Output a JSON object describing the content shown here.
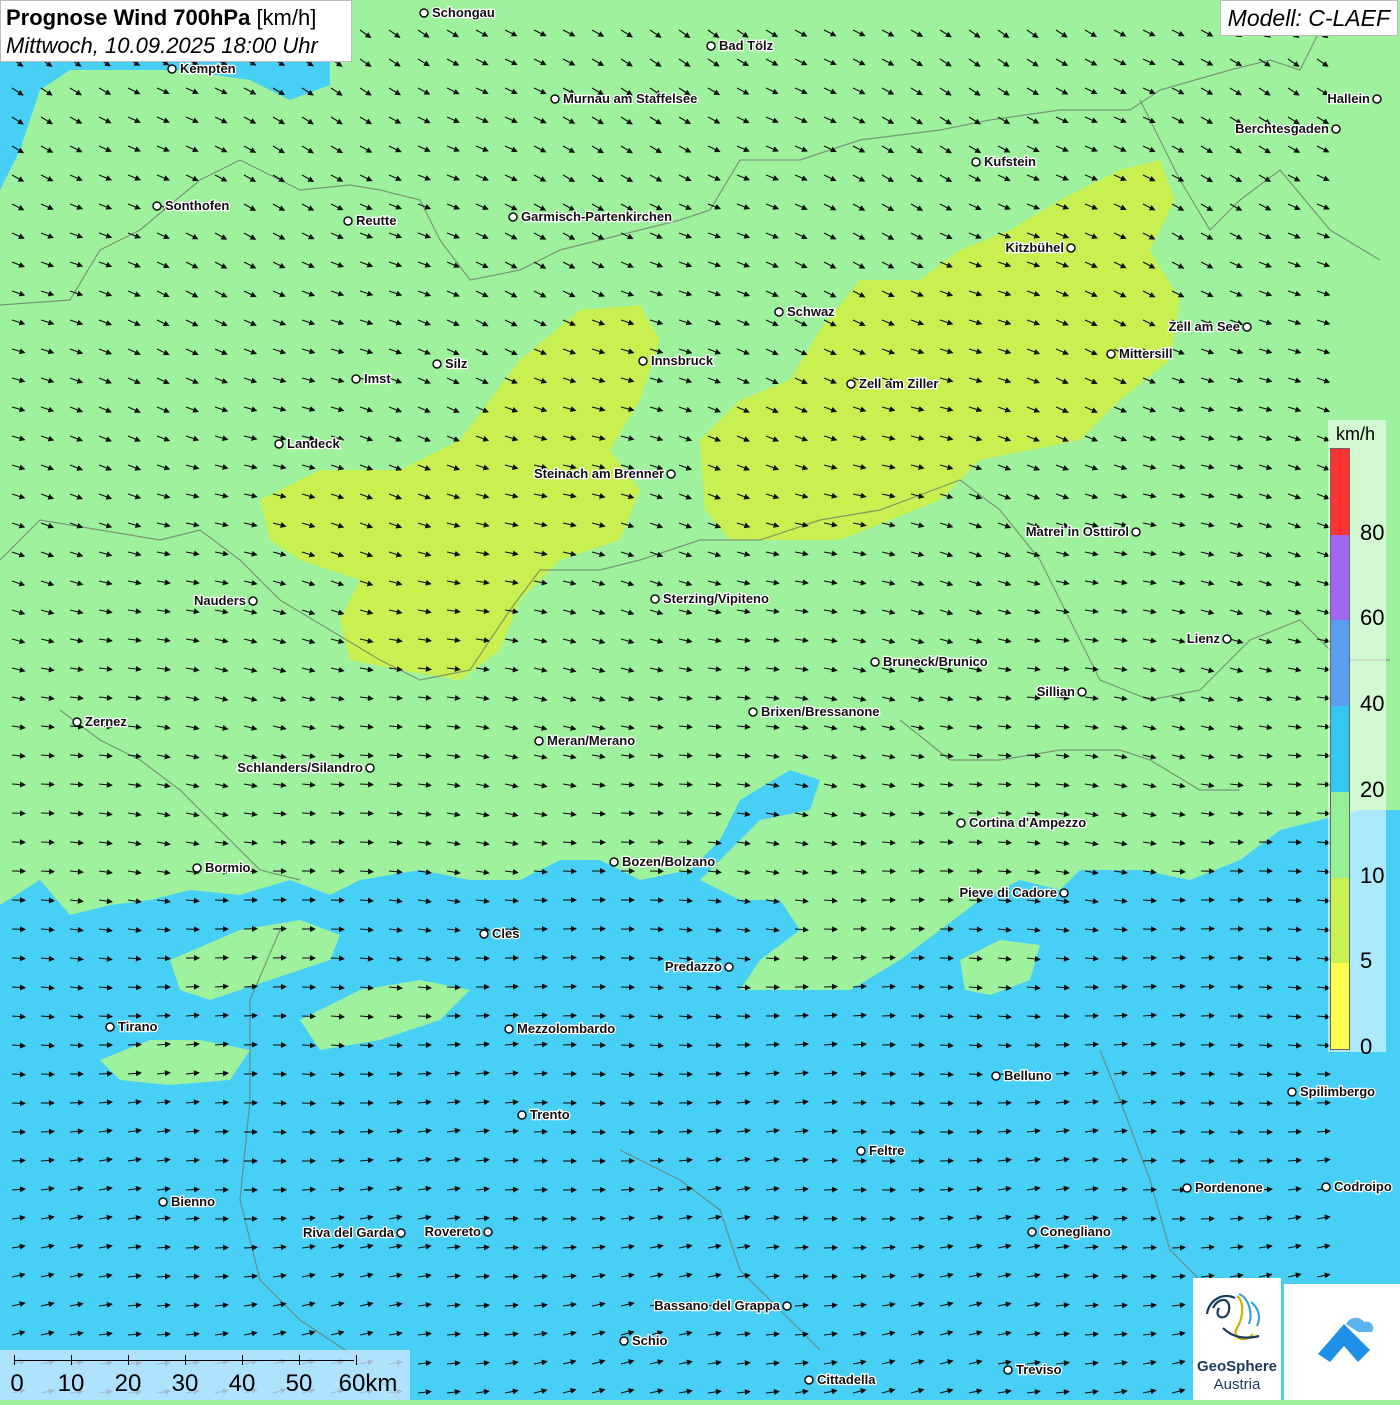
{
  "title": {
    "bold": "Prognose Wind 700hPa",
    "unit": "[km/h]",
    "datetime": "Mittwoch, 10.09.2025 18:00 Uhr"
  },
  "model": "Modell: C-LAEF",
  "legend": {
    "unit": "km/h",
    "labels": [
      "80",
      "60",
      "40",
      "20",
      "10",
      "5",
      "0"
    ],
    "colors": [
      "#ff3232",
      "#a068f0",
      "#5a9ef0",
      "#32c8f0",
      "#96f096",
      "#c8f050",
      "#ffff50"
    ]
  },
  "scalebar": {
    "labels": [
      "0",
      "10",
      "20",
      "30",
      "40",
      "50",
      "60km"
    ]
  },
  "logos": {
    "geosphere_line1": "GeoSphere",
    "geosphere_line2": "Austria"
  },
  "colors": {
    "zone_5_10": "#c8f050",
    "zone_10_20": "#9ef29e",
    "zone_20_40": "#48cff5"
  },
  "cities": [
    {
      "name": "Schongau"
    },
    {
      "name": "Bad Tölz"
    },
    {
      "name": "Kempten"
    },
    {
      "name": "Murnau am Staffelsee"
    },
    {
      "name": "Hallein"
    },
    {
      "name": "Berchtesgaden"
    },
    {
      "name": "Kufstein"
    },
    {
      "name": "Sonthofen"
    },
    {
      "name": "Reutte"
    },
    {
      "name": "Garmisch-Partenkirchen"
    },
    {
      "name": "Kitzbühel"
    },
    {
      "name": "Schwaz"
    },
    {
      "name": "Zell am See"
    },
    {
      "name": "Innsbruck"
    },
    {
      "name": "Mittersill"
    },
    {
      "name": "Silz"
    },
    {
      "name": "Imst"
    },
    {
      "name": "Zell am Ziller"
    },
    {
      "name": "Landeck"
    },
    {
      "name": "Steinach am Brenner"
    },
    {
      "name": "Matrei in Osttirol"
    },
    {
      "name": "Nauders"
    },
    {
      "name": "Sterzing/Vipiteno"
    },
    {
      "name": "Lienz"
    },
    {
      "name": "Bruneck/Brunico"
    },
    {
      "name": "Sillian"
    },
    {
      "name": "Brixen/Bressanone"
    },
    {
      "name": "Zernez"
    },
    {
      "name": "Meran/Merano"
    },
    {
      "name": "Schlanders/Silandro"
    },
    {
      "name": "Cortina d'Ampezzo"
    },
    {
      "name": "Bormio"
    },
    {
      "name": "Bozen/Bolzano"
    },
    {
      "name": "Pieve di Cadore"
    },
    {
      "name": "Cles"
    },
    {
      "name": "Predazzo"
    },
    {
      "name": "Tirano"
    },
    {
      "name": "Mezzolombardo"
    },
    {
      "name": "Belluno"
    },
    {
      "name": "Spilimbergo"
    },
    {
      "name": "Trento"
    },
    {
      "name": "Feltre"
    },
    {
      "name": "Bienno"
    },
    {
      "name": "Pordenone"
    },
    {
      "name": "Codroipo"
    },
    {
      "name": "Riva del Garda"
    },
    {
      "name": "Rovereto"
    },
    {
      "name": "Conegliano"
    },
    {
      "name": "Bassano del Grappa"
    },
    {
      "name": "Schio"
    },
    {
      "name": "Treviso"
    },
    {
      "name": "Cittadella"
    }
  ]
}
